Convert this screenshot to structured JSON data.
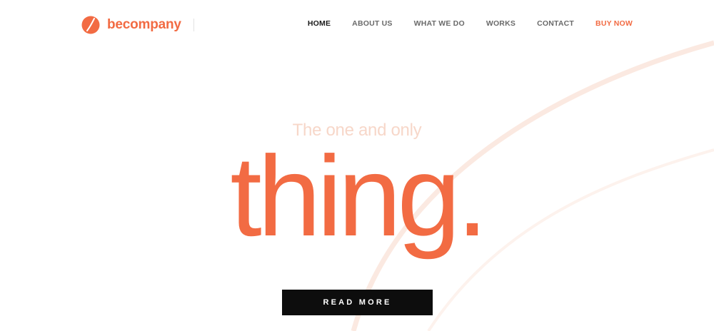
{
  "brand": {
    "name": "becompany",
    "accent_color": "#f26b43",
    "icon": "logo-swoosh-icon"
  },
  "nav": {
    "items": [
      {
        "label": "HOME",
        "active": true
      },
      {
        "label": "ABOUT US",
        "active": false
      },
      {
        "label": "WHAT WE DO",
        "active": false
      },
      {
        "label": "WORKS",
        "active": false
      },
      {
        "label": "CONTACT",
        "active": false
      },
      {
        "label": "BUY NOW",
        "active": false,
        "highlight": true
      }
    ],
    "active_color": "#1a1a1a",
    "text_color": "#6a6a6a",
    "highlight_color": "#f26b43"
  },
  "hero": {
    "subtitle": "The one and only",
    "subtitle_color": "#f7d7c9",
    "headline": "thing.",
    "headline_color": "#f26b43",
    "cta_label": "READ MORE",
    "cta_background": "#0d0d0d",
    "curve_color": "#fbe9e1"
  }
}
